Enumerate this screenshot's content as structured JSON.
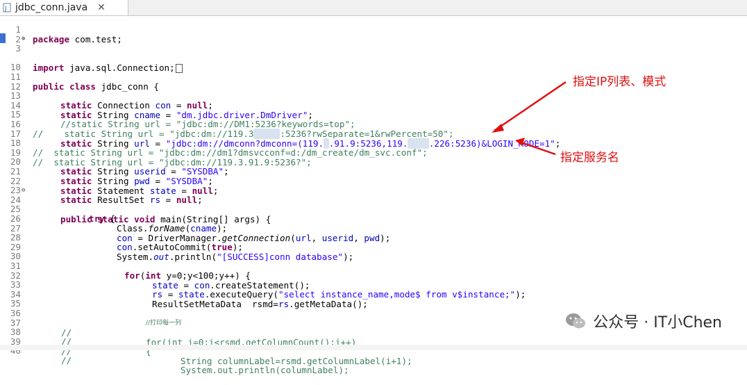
{
  "tab": {
    "title": "jdbc_conn.java",
    "close": "✕",
    "icon": "java-file-icon"
  },
  "lines": [
    {
      "n": "1"
    },
    {
      "n": "2"
    },
    {
      "n": "3"
    },
    {
      "n": "10"
    },
    {
      "n": "11"
    },
    {
      "n": "12"
    },
    {
      "n": "13"
    },
    {
      "n": "14"
    },
    {
      "n": "15"
    },
    {
      "n": "16"
    },
    {
      "n": "17"
    },
    {
      "n": "18"
    },
    {
      "n": "19"
    },
    {
      "n": "20"
    },
    {
      "n": "21"
    },
    {
      "n": "22"
    },
    {
      "n": "23"
    },
    {
      "n": "24"
    },
    {
      "n": "25"
    },
    {
      "n": "26"
    },
    {
      "n": "27"
    },
    {
      "n": "28"
    },
    {
      "n": "29"
    },
    {
      "n": "30"
    },
    {
      "n": "31"
    },
    {
      "n": "32"
    },
    {
      "n": "33"
    },
    {
      "n": "34"
    },
    {
      "n": "35"
    },
    {
      "n": "36"
    },
    {
      "n": "37"
    },
    {
      "n": "38"
    },
    {
      "n": "39"
    },
    {
      "n": "40"
    }
  ],
  "code": {
    "l1_kw": "package",
    "l1_rest": " com.test;",
    "l3_kw": "import",
    "l3_rest": " java.sql.Connection;",
    "l11_kw": "public class",
    "l11_rest": " jdbc_conn {",
    "l13_kw": "static",
    "l13_type": " Connection ",
    "l13_fld": "con",
    "l13_eq": " = ",
    "l13_null": "null",
    "l13_end": ";",
    "l14_kw": "static",
    "l14_type": " String ",
    "l14_fld": "cname",
    "l14_eq": " = ",
    "l14_str": "\"dm.jdbc.driver.DmDriver\"",
    "l14_end": ";",
    "l15_cmt": "//static String url = \"jdbc:dm://DM1:5236?keywords=top\";",
    "l16_cmt": "//    static String url = \"jdbc:dm://119.3",
    "l16_tail": ":5236?rwSeparate=1&rwPercent=50\";",
    "l17_kw": "static",
    "l17_type": " String ",
    "l17_fld": "url",
    "l17_eq": " = ",
    "l17_str_a": "\"jdbc:dm://dmconn?dmconn=(119.",
    "l17_str_b": ".91.9:5236,119.",
    "l17_str_c": ".226:5236)&LOGIN_MODE=1\"",
    "l17_end": ";",
    "l18_cmt": "//  static String url = \"jdbc:dm://dm1?dmsvcconf=d:/dm_create/dm_svc.conf\";",
    "l19_cmt": "//  static String url = \"jdbc:dm://119.3.91.9:5236?\";",
    "l20_kw": "static",
    "l20_type": " String ",
    "l20_fld": "userid",
    "l20_eq": " = ",
    "l20_str": "\"SYSDBA\"",
    "l20_end": ";",
    "l21_kw": "static",
    "l21_type": " String ",
    "l21_fld": "pwd",
    "l21_eq": " = ",
    "l21_str": "\"SYSDBA\"",
    "l21_end": ";",
    "l22_kw": "static",
    "l22_type": " Statement ",
    "l22_fld": "state",
    "l22_eq": " = ",
    "l22_null": "null",
    "l22_end": ";",
    "l23_kw": "static",
    "l23_type": " ResultSet ",
    "l23_fld": "rs",
    "l23_eq": " = ",
    "l23_null": "null",
    "l23_end": ";",
    "l24_kw": "public static void",
    "l24_rest": " main(String[] args) {",
    "l25_kw": "try",
    "l25_rest": " {",
    "l26_a": "Class.",
    "l26_b": "forName",
    "l26_c": "(",
    "l26_fld": "cname",
    "l26_d": ");",
    "l27_fld": "con",
    "l27_a": " = DriverManager.",
    "l27_b": "getConnection",
    "l27_c": "(",
    "l27_f1": "url",
    "l27_sep1": ", ",
    "l27_f2": "userid",
    "l27_sep2": ", ",
    "l27_f3": "pwd",
    "l27_d": ");",
    "l28_fld": "con",
    "l28_a": ".setAutoCommit(",
    "l28_kw": "true",
    "l28_b": ");",
    "l29_a": "System.",
    "l29_fld": "out",
    "l29_b": ".println(",
    "l29_str": "\"[SUCCESS]conn database\"",
    "l29_c": ");",
    "l31_kw1": "for",
    "l31_a": "(",
    "l31_kw2": "int",
    "l31_b": " y=0;y<100;y++) {",
    "l32_fld": "state",
    "l32_a": " = ",
    "l32_fld2": "con",
    "l32_b": ".createStatement();",
    "l33_fld": "rs",
    "l33_a": " = ",
    "l33_fld2": "state",
    "l33_b": ".executeQuery(",
    "l33_str": "\"select instance_name,mode$ from v$instance;\"",
    "l33_c": ");",
    "l34_a": "ResultSetMetaData  rsmd=",
    "l34_fld": "rs",
    "l34_b": ".getMetaData();",
    "l36_cmt": "//打印每一列",
    "l37_cmt": "//",
    "l37_rest": "for(int i=0;i<rsmd.getColumnCount();i++)",
    "l38_cmt": "//",
    "l38_rest": "{",
    "l39_cmt": "//",
    "l39_rest": "String columnLabel=rsmd.getColumnLabel(i+1);",
    "l40_cmt": "//",
    "l40_rest": "System.out.println(columnLabel);"
  },
  "annotations": {
    "ip_list": "指定IP列表、模式",
    "service": "指定服务名",
    "color": "#e01010"
  },
  "watermark": {
    "text": "公众号 · IT小Chen",
    "icon": "wechat-icon"
  }
}
